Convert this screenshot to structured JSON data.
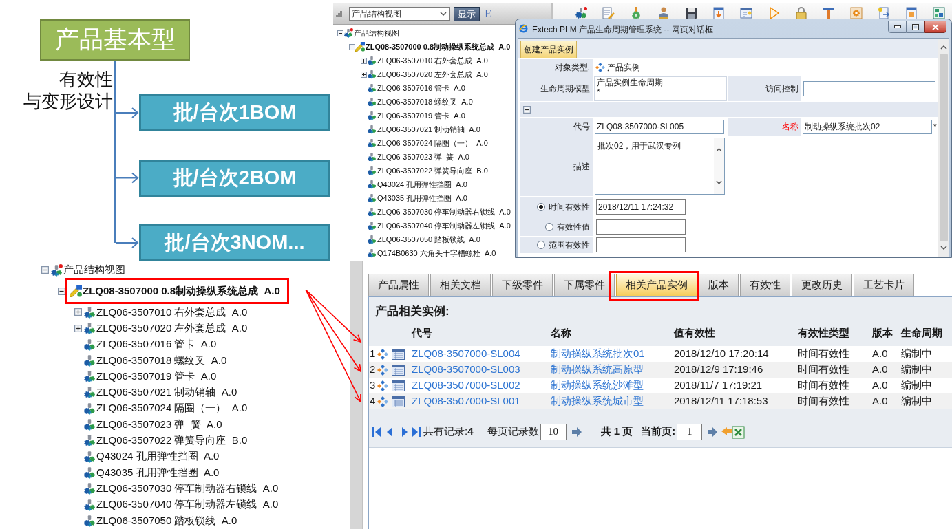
{
  "diagram": {
    "base_model": "产品基本型",
    "branch_label": [
      "有效性",
      "与变形设计"
    ],
    "variants": [
      "批/台次1BOM",
      "批/台次2BOM",
      "批/台次3NOM..."
    ]
  },
  "top_window": {
    "view_select": {
      "value": "产品结构视图"
    },
    "show_button": "显示",
    "toolbar_fragment": "E",
    "tree": [
      {
        "label": "产品结构视图",
        "kind": "view",
        "has_children": true,
        "expanded": true,
        "children": [
          {
            "label": "ZLQ08-3507000 0.8制动操纵系统总成  A.0",
            "kind": "product",
            "has_children": true,
            "expanded": true,
            "children": [
              {
                "label": "ZLQ06-3507010 右外套总成  A.0",
                "kind": "part",
                "has_children": true,
                "expanded": false
              },
              {
                "label": "ZLQ06-3507020 左外套总成  A.0",
                "kind": "part",
                "has_children": true,
                "expanded": false
              },
              {
                "label": "ZLQ06-3507016 管卡  A.0",
                "kind": "part",
                "has_children": false,
                "expanded": false
              },
              {
                "label": "ZLQ06-3507018 螺纹叉  A.0",
                "kind": "part",
                "has_children": false,
                "expanded": false
              },
              {
                "label": "ZLQ06-3507019 管卡  A.0",
                "kind": "part",
                "has_children": false,
                "expanded": false
              },
              {
                "label": "ZLQ06-3507021 制动销轴  A.0",
                "kind": "part",
                "has_children": false,
                "expanded": false
              },
              {
                "label": "ZLQ06-3507024 隔圈（一）  A.0",
                "kind": "part",
                "has_children": false,
                "expanded": false
              },
              {
                "label": "ZLQ06-3507023 弹  簧  A.0",
                "kind": "part",
                "has_children": false,
                "expanded": false
              },
              {
                "label": "ZLQ06-3507022 弹簧导向座  B.0",
                "kind": "part",
                "has_children": false,
                "expanded": false
              },
              {
                "label": "Q43024 孔用弹性挡圈  A.0",
                "kind": "part",
                "has_children": false,
                "expanded": false
              },
              {
                "label": "Q43035 孔用弹性挡圈  A.0",
                "kind": "part",
                "has_children": false,
                "expanded": false
              },
              {
                "label": "ZLQ06-3507030 停车制动器右锁线  A.0",
                "kind": "part",
                "has_children": false,
                "expanded": false
              },
              {
                "label": "ZLQ06-3507040 停车制动器左锁线  A.0",
                "kind": "part",
                "has_children": false,
                "expanded": false
              },
              {
                "label": "ZLQ06-3507050 踏板锁线  A.0",
                "kind": "part",
                "has_children": false,
                "expanded": false
              },
              {
                "label": "Q174B0630 六角头十字槽螺栓  A.0",
                "kind": "part",
                "has_children": false,
                "expanded": false
              }
            ]
          }
        ]
      }
    ]
  },
  "dialog": {
    "title": "Extech PLM 产品生命周期管理系统 -- 网页对话框",
    "tabs": [
      {
        "label": "创建产品实例",
        "selected": true
      }
    ],
    "object_type": {
      "label": "对象类型.",
      "value": "产品实例",
      "required": false
    },
    "lifecycle_model": {
      "label": "生命周期模型",
      "value_lines": [
        "产品实例生命周期",
        "*"
      ],
      "required": false
    },
    "access_control": {
      "label": "访问控制",
      "required": false
    },
    "section": {
      "expanded": true
    },
    "code": {
      "label": "代号",
      "value": "ZLQ08-3507000-SL005",
      "required": false
    },
    "name": {
      "label": "名称",
      "value": "制动操纵系统批次02",
      "required": true,
      "mark": "*"
    },
    "description": {
      "label": "描述",
      "value": "批次02，用于武汉专列",
      "required": false
    },
    "effectivity": [
      {
        "label": "时间有效性",
        "selected": true,
        "value": "2018/12/11 17:24:32"
      },
      {
        "label": "有效性值",
        "selected": false
      },
      {
        "label": "范围有效性",
        "selected": false
      }
    ]
  },
  "bottom_tree": [
    {
      "label": "产品结构视图",
      "kind": "view",
      "has_children": true,
      "expanded": true,
      "children": [
        {
          "label": "ZLQ08-3507000 0.8制动操纵系统总成  A.0",
          "kind": "product",
          "has_children": true,
          "expanded": true,
          "children": [
            {
              "label": "ZLQ06-3507010 右外套总成  A.0",
              "kind": "part",
              "has_children": true,
              "expanded": false
            },
            {
              "label": "ZLQ06-3507020 左外套总成  A.0",
              "kind": "part",
              "has_children": true,
              "expanded": false
            },
            {
              "label": "ZLQ06-3507016 管卡  A.0",
              "kind": "part",
              "has_children": false,
              "expanded": false
            },
            {
              "label": "ZLQ06-3507018 螺纹叉  A.0",
              "kind": "part",
              "has_children": false,
              "expanded": false
            },
            {
              "label": "ZLQ06-3507019 管卡  A.0",
              "kind": "part",
              "has_children": false,
              "expanded": false
            },
            {
              "label": "ZLQ06-3507021 制动销轴  A.0",
              "kind": "part",
              "has_children": false,
              "expanded": false
            },
            {
              "label": "ZLQ06-3507024 隔圈（一）  A.0",
              "kind": "part",
              "has_children": false,
              "expanded": false
            },
            {
              "label": "ZLQ06-3507023 弹  簧  A.0",
              "kind": "part",
              "has_children": false,
              "expanded": false
            },
            {
              "label": "ZLQ06-3507022 弹簧导向座  B.0",
              "kind": "part",
              "has_children": false,
              "expanded": false
            },
            {
              "label": "Q43024 孔用弹性挡圈  A.0",
              "kind": "part",
              "has_children": false,
              "expanded": false
            },
            {
              "label": "Q43035 孔用弹性挡圈  A.0",
              "kind": "part",
              "has_children": false,
              "expanded": false
            },
            {
              "label": "ZLQ06-3507030 停车制动器右锁线  A.0",
              "kind": "part",
              "has_children": false,
              "expanded": false
            },
            {
              "label": "ZLQ06-3507040 停车制动器左锁线  A.0",
              "kind": "part",
              "has_children": false,
              "expanded": false
            },
            {
              "label": "ZLQ06-3507050 踏板锁线  A.0",
              "kind": "part",
              "has_children": false,
              "expanded": false
            }
          ]
        }
      ]
    }
  ],
  "detail_panel": {
    "tabs": [
      {
        "label": "产品属性",
        "selected": false
      },
      {
        "label": "相关文档",
        "selected": false
      },
      {
        "label": "下级零件",
        "selected": false
      },
      {
        "label": "下属零件",
        "selected": false
      },
      {
        "label": "相关产品实例",
        "selected": true
      },
      {
        "label": "版本",
        "selected": false
      },
      {
        "label": "有效性",
        "selected": false
      },
      {
        "label": "更改历史",
        "selected": false
      },
      {
        "label": "工艺卡片",
        "selected": false
      }
    ],
    "heading": "产品相关实例:",
    "columns": [
      "代号",
      "名称",
      "值有效性",
      "有效性类型",
      "版本",
      "生命周期"
    ],
    "rows": [
      {
        "number": "1",
        "code": "ZLQ08-3507000-SL004",
        "name": "制动操纵系统批次01",
        "effective": "2018/12/10 17:20:14",
        "type": "时间有效性",
        "version": "A.0",
        "lifecycle": "编制中"
      },
      {
        "number": "2",
        "code": "ZLQ08-3507000-SL003",
        "name": "制动操纵系统高原型",
        "effective": "2018/12/9 17:19:46",
        "type": "时间有效性",
        "version": "A.0",
        "lifecycle": "编制中"
      },
      {
        "number": "3",
        "code": "ZLQ08-3507000-SL002",
        "name": "制动操纵系统沙滩型",
        "effective": "2018/11/7 17:19:21",
        "type": "时间有效性",
        "version": "A.0",
        "lifecycle": "编制中"
      },
      {
        "number": "4",
        "code": "ZLQ08-3507000-SL001",
        "name": "制动操纵系统城市型",
        "effective": "2018/12/11 17:18:53",
        "type": "时间有效性",
        "version": "A.0",
        "lifecycle": "编制中"
      }
    ],
    "pager": {
      "total": "共有记录:**4**",
      "per_page_label": "每页记录数",
      "per_page": "10",
      "pages": "共 1 页",
      "current_label": "当前页:",
      "current": "1"
    }
  }
}
